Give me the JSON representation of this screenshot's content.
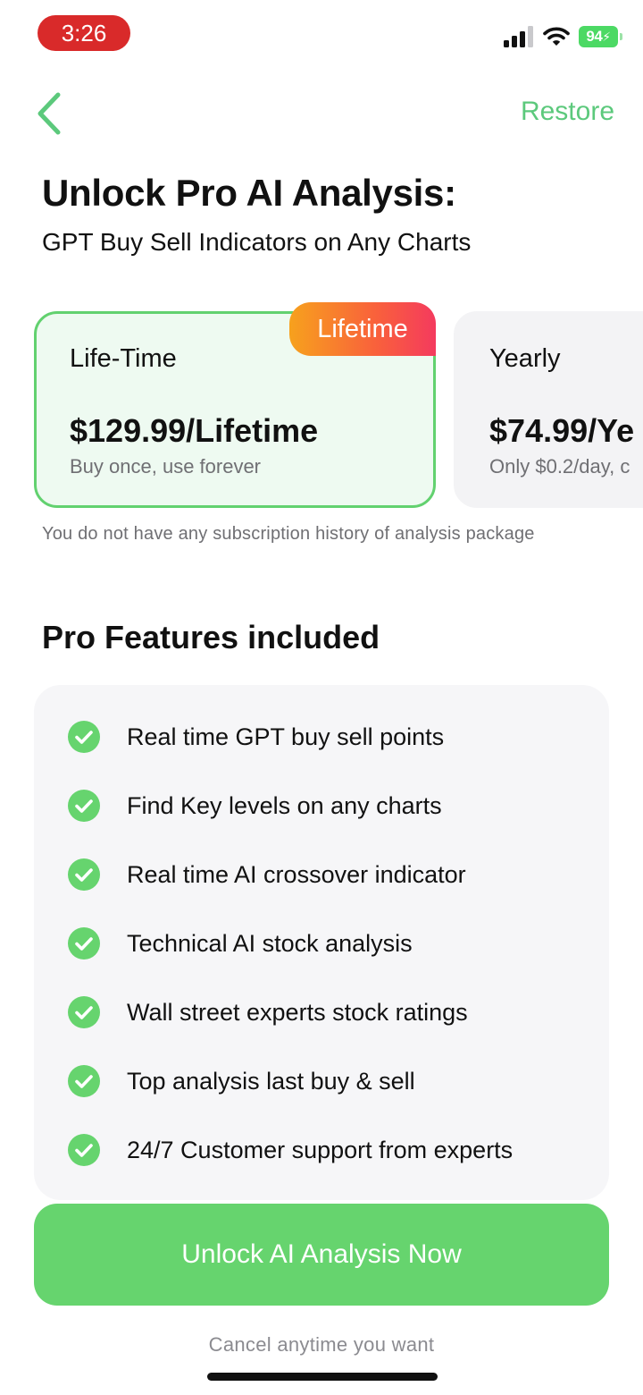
{
  "status_bar": {
    "time": "3:26",
    "battery": "94",
    "icons": [
      "signal-icon",
      "wifi-icon",
      "battery-icon"
    ]
  },
  "nav": {
    "back_icon": "chevron-left-icon",
    "restore_label": "Restore"
  },
  "header": {
    "title": "Unlock Pro AI Analysis:",
    "subtitle": "GPT Buy Sell Indicators on Any Charts"
  },
  "plans": [
    {
      "name": "Life-Time",
      "price": "$129.99/Lifetime",
      "note": "Buy once, use forever",
      "badge": "Lifetime",
      "selected": true
    },
    {
      "name": "Yearly",
      "price": "$74.99/Ye",
      "note": "Only $0.2/day, c",
      "selected": false
    }
  ],
  "history_note": "You do not have any subscription history of analysis package",
  "features": {
    "title": "Pro Features included",
    "items": [
      "Real time GPT buy sell points",
      "Find Key levels on any charts",
      "Real time AI crossover indicator",
      "Technical AI stock analysis",
      "Wall street experts stock ratings",
      "Top analysis last buy & sell",
      "24/7 Customer support from experts"
    ]
  },
  "cta": {
    "label": "Unlock AI Analysis Now",
    "footnote": "Cancel anytime you want"
  },
  "colors": {
    "accent_green": "#66d46e",
    "link_green": "#5cc97c",
    "badge_gradient_start": "#f7a11d",
    "badge_gradient_end": "#f43a5e",
    "status_time_bg": "#d92a2a"
  }
}
